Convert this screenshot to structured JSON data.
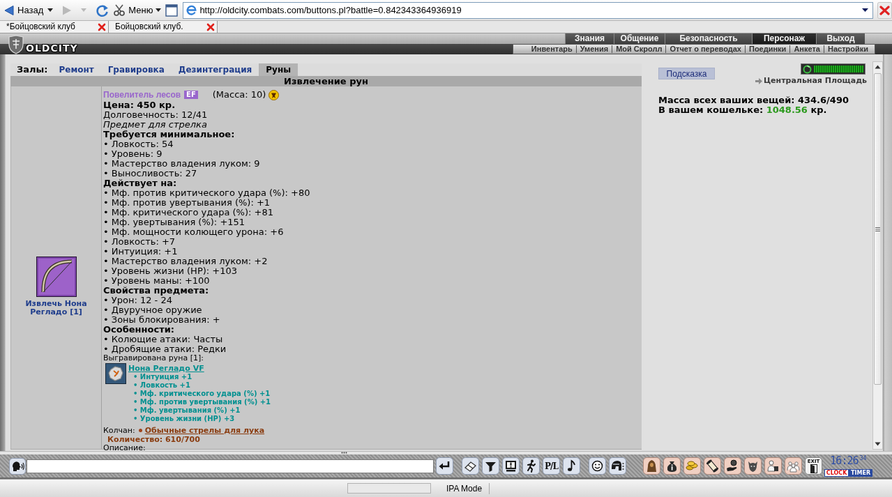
{
  "browser": {
    "back_label": "Назад",
    "forward_disabled": true,
    "menu_label": "Меню",
    "url": "http://oldcity.combats.com/buttons.pl?battle=0.842343364936919",
    "tabs": [
      {
        "title": "*Бойцовский клуб"
      },
      {
        "title": "Бойцовский клуб."
      }
    ]
  },
  "header": {
    "logo_text": "OLDCITY",
    "top_menu": [
      {
        "label": "Знания",
        "selected": false
      },
      {
        "label": "Общение",
        "selected": false
      },
      {
        "label": "Безопасность",
        "selected": false
      },
      {
        "label": "Персонаж",
        "selected": true
      },
      {
        "label": "Выход",
        "selected": false
      }
    ],
    "sub_menu": [
      "Инвентарь",
      "Умения",
      "Мой Скролл",
      "Отчет о переводах",
      "Поединки",
      "Анкета",
      "Настройки"
    ]
  },
  "halls": {
    "label": "Залы:",
    "tabs": [
      {
        "label": "Ремонт",
        "selected": false
      },
      {
        "label": "Гравировка",
        "selected": false
      },
      {
        "label": "Дезинтеграция",
        "selected": false
      },
      {
        "label": "Руны",
        "selected": true
      }
    ]
  },
  "section_title": "Извлечение рун",
  "item": {
    "action_link": "Извлечь Нона Регладо [1]",
    "name": "Повелитель лесов",
    "badge": "EF",
    "mass": "(Масса: 10)",
    "price": "Цена: 450 кр.",
    "durability": "Долговечность: 12/41",
    "class_note": "Предмет для стрелка",
    "sections": [
      {
        "title": "Требуется минимальное:",
        "lines": [
          "• Ловкость: 54",
          "• Уровень: 9",
          "• Мастерство владения луком: 9",
          "• Выносливость: 27"
        ]
      },
      {
        "title": "Действует на:",
        "lines": [
          "• Мф. против критического удара (%): +80",
          "• Мф. против увертывания (%): +1",
          "• Мф. критического удара (%): +81",
          "• Мф. увертывания (%): +151",
          "• Мф. мощности колющего урона: +6",
          "• Ловкость: +7",
          "• Интуиция: +1",
          "• Мастерство владения луком: +2",
          "• Уровень жизни (HP): +103",
          "• Уровень маны: +100"
        ]
      },
      {
        "title": "Свойства предмета:",
        "lines": [
          "• Урон: 12 - 24",
          "• Двуручное оружие",
          "• Зоны блокирования: +"
        ]
      },
      {
        "title": "Особенности:",
        "lines": [
          "• Колющие атаки: Часты",
          "• Дробящие атаки: Редки"
        ]
      }
    ],
    "engraving": {
      "title": "Выгравирована руна [1]:",
      "rune_name": "Нона Регладо VF",
      "bonuses": [
        "• Интуиция +1",
        "• Ловкость +1",
        "• Мф. критического удара (%) +1",
        "• Мф. против увертывания (%) +1",
        "• Мф. увертывания (%) +1",
        "• Уровень жизни (HP) +3"
      ]
    },
    "quiver": {
      "label": "Колчан:",
      "arrows": "Обычные стрелы для лука",
      "quantity": "Количество: 610/700"
    },
    "description_label": "Описание:"
  },
  "side_panel": {
    "hint_button": "Подсказка",
    "meter": {
      "level": 1
    },
    "location_link": "Центральная Площадь",
    "mass_total": "Масса всех ваших вещей: 434.6/490",
    "wallet_label": "В вашем кошельке:",
    "wallet_amount": "1048.56",
    "wallet_unit": "кр."
  },
  "chat_bar": {
    "pl_label": "P/L",
    "exit_label": "EXIT",
    "clock_time": "16:26",
    "clock_seconds": "34",
    "clock_tabs": [
      {
        "label": "CLOCK",
        "selected": true
      },
      {
        "label": "TIMER",
        "selected": false
      }
    ]
  },
  "status_bar": {
    "mode": "IPA Mode"
  }
}
